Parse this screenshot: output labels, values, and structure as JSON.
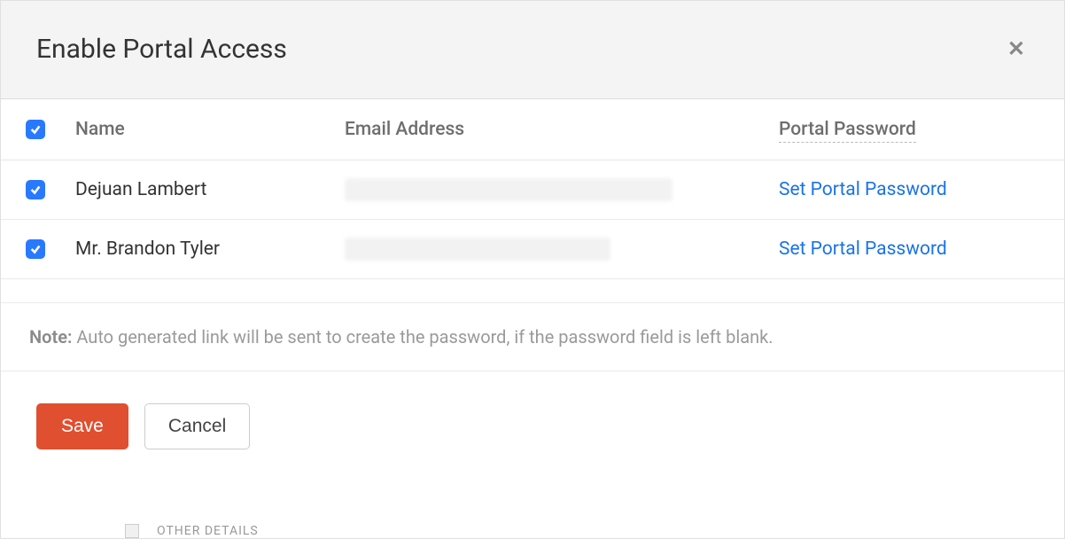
{
  "modal": {
    "title": "Enable Portal Access"
  },
  "columns": {
    "name": "Name",
    "email": "Email Address",
    "password": "Portal Password"
  },
  "rows": [
    {
      "name": "Dejuan Lambert",
      "action": "Set Portal Password",
      "checked": true
    },
    {
      "name": "Mr. Brandon Tyler",
      "action": "Set Portal Password",
      "checked": true
    }
  ],
  "note": {
    "label": "Note:",
    "text": " Auto generated link will be sent to create the password, if the password field is left blank."
  },
  "buttons": {
    "save": "Save",
    "cancel": "Cancel"
  },
  "hidden_section": "OTHER DETAILS"
}
